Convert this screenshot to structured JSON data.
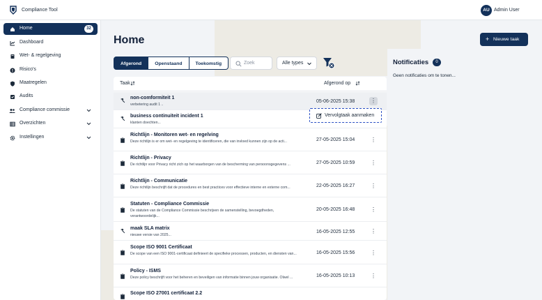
{
  "app": {
    "name": "Compliance Tool",
    "logo_icon": "shield-logo-icon"
  },
  "user": {
    "initials": "AU",
    "name": "Admin User"
  },
  "sidebar": {
    "items": [
      {
        "label": "Home",
        "icon": "home-icon",
        "badge": "32",
        "active": true
      },
      {
        "label": "Dashboard",
        "icon": "chart-icon"
      },
      {
        "label": "Wet- & regelgeving",
        "icon": "book-icon"
      },
      {
        "label": "Risico's",
        "icon": "alert-icon"
      },
      {
        "label": "Maatregelen",
        "icon": "shield-icon"
      },
      {
        "label": "Audits",
        "icon": "audit-icon"
      },
      {
        "label": "Compliance commissie",
        "icon": "people-icon",
        "expandable": true
      },
      {
        "label": "Overzichten",
        "icon": "table-icon",
        "expandable": true
      },
      {
        "label": "Instellingen",
        "icon": "gear-icon",
        "expandable": true
      }
    ]
  },
  "main": {
    "title": "Home",
    "new_task_label": "Nieuwe taak",
    "tabs": [
      {
        "label": "Afgerond",
        "active": true
      },
      {
        "label": "Openstaand"
      },
      {
        "label": "Toekomstig"
      }
    ],
    "search": {
      "placeholder": "Zoek"
    },
    "type_select": {
      "value": "Alle types"
    },
    "table": {
      "headers": {
        "task": "Taak",
        "completed_on": "Afgerond op"
      },
      "rows": [
        {
          "icon": "hammer-icon",
          "title": "non-comformiteit 1",
          "description": "verbetering audit 1 ..",
          "date": "05-06-2025 15:38"
        },
        {
          "icon": "hammer-icon",
          "title": "business continuiteit incident 1",
          "description": "klanten doechten...",
          "date": ""
        },
        {
          "icon": "clipboard-icon",
          "title": "Richtlijn - Monitoren wet- en regelving",
          "description": "Deze richtlijn is er om wet- en regelgeving te identificeren, die van invloed kunnen zijn op de acti...",
          "date": "27-05-2025 15:04"
        },
        {
          "icon": "clipboard-icon",
          "title": "Richtlijn - Privacy",
          "description": "De richtlijn voor Privacy richt zich op het waarborgen van de bescherming van persoonsgegevens ...",
          "date": "27-05-2025 10:59"
        },
        {
          "icon": "clipboard-icon",
          "title": "Richtlijn - Communicatie",
          "description": "Deze richtlijn beschrijft dat de procedures en best practices voor effectieve interne en externe com...",
          "date": "22-05-2025 16:27"
        },
        {
          "icon": "clipboard-icon",
          "title": "Statuten - Compliance Commissie",
          "description": "De statuten van de Compliance Commissie beschrijven de samenstelling, bevoegdheden, verantwoordelijk...",
          "date": "20-05-2025 16:48"
        },
        {
          "icon": "hammer-icon",
          "title": "maak SLA matrix",
          "description": "nieuwe versie van 2025...",
          "date": "16-05-2025 12:55"
        },
        {
          "icon": "clipboard-icon",
          "title": "Scope ISO 9001 Certificaat",
          "description": "De scope van een ISO 9001-certificaat definieert de specifieke processen, producten, en diensten van...",
          "date": "16-05-2025 15:56"
        },
        {
          "icon": "clipboard-icon",
          "title": "Policy - ISMS",
          "description": "Deze policy beschrijft voor het beheren en beveiligen van informatie binnen jouw organisatie. Olwel ...",
          "date": "16-05-2025 10:13"
        },
        {
          "icon": "clipboard-icon",
          "title": "Scope ISO 27001 certificaat 2.2",
          "description": "",
          "date": ""
        }
      ]
    },
    "row_menu": {
      "item_label": "Vervolgtaak aanmaken",
      "item_icon": "edit-icon"
    }
  },
  "notifications": {
    "title": "Notificaties",
    "count": "0",
    "empty_text": "Geen notificaties om te tonen..."
  },
  "colors": {
    "primary": "#13315a",
    "accent_dashed": "#2a4fc4",
    "background": "#f2f4f7"
  }
}
